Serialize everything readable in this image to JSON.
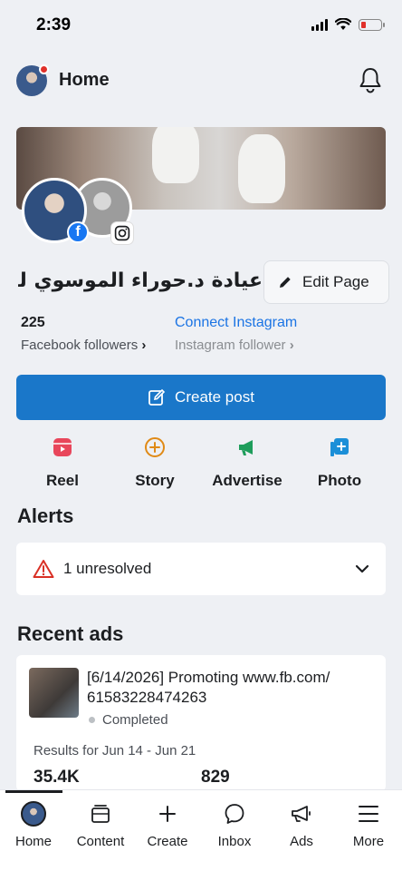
{
  "status_bar": {
    "time": "2:39"
  },
  "header": {
    "title": "Home"
  },
  "page": {
    "name": "عيادة د.حوراء الموسوي لـ...",
    "edit_label": "Edit Page"
  },
  "stats": {
    "facebook_count": "225",
    "facebook_label": "Facebook followers",
    "connect_instagram": "Connect Instagram",
    "instagram_label": "Instagram follower"
  },
  "create_post": {
    "label": "Create post"
  },
  "actions": [
    {
      "label": "Reel",
      "icon": "reel-icon"
    },
    {
      "label": "Story",
      "icon": "story-plus-icon"
    },
    {
      "label": "Advertise",
      "icon": "megaphone-icon"
    },
    {
      "label": "Photo",
      "icon": "photo-plus-icon"
    }
  ],
  "alerts": {
    "title": "Alerts",
    "summary": "1 unresolved"
  },
  "recent_ads": {
    "title": "Recent ads",
    "ad": {
      "title": "[6/14/2026] Promoting www.fb.com/ 61583228474263",
      "status": "Completed",
      "results_label": "Results for Jun 14 - Jun 21",
      "metric_1": "35.4K",
      "metric_2": "829"
    }
  },
  "tabs": [
    {
      "label": "Home",
      "icon": "profile-avatar-icon"
    },
    {
      "label": "Content",
      "icon": "content-icon"
    },
    {
      "label": "Create",
      "icon": "plus-icon"
    },
    {
      "label": "Inbox",
      "icon": "chat-bubble-icon"
    },
    {
      "label": "Ads",
      "icon": "megaphone-icon"
    },
    {
      "label": "More",
      "icon": "menu-icon"
    }
  ],
  "colors": {
    "brand_blue": "#1a77c9",
    "link_blue": "#1b74e4",
    "reel_red": "#e8465b",
    "story_orange": "#e08a16",
    "advertise_green": "#1e9d5b",
    "photo_blue": "#1b8fd8",
    "alert_red": "#d93025"
  }
}
